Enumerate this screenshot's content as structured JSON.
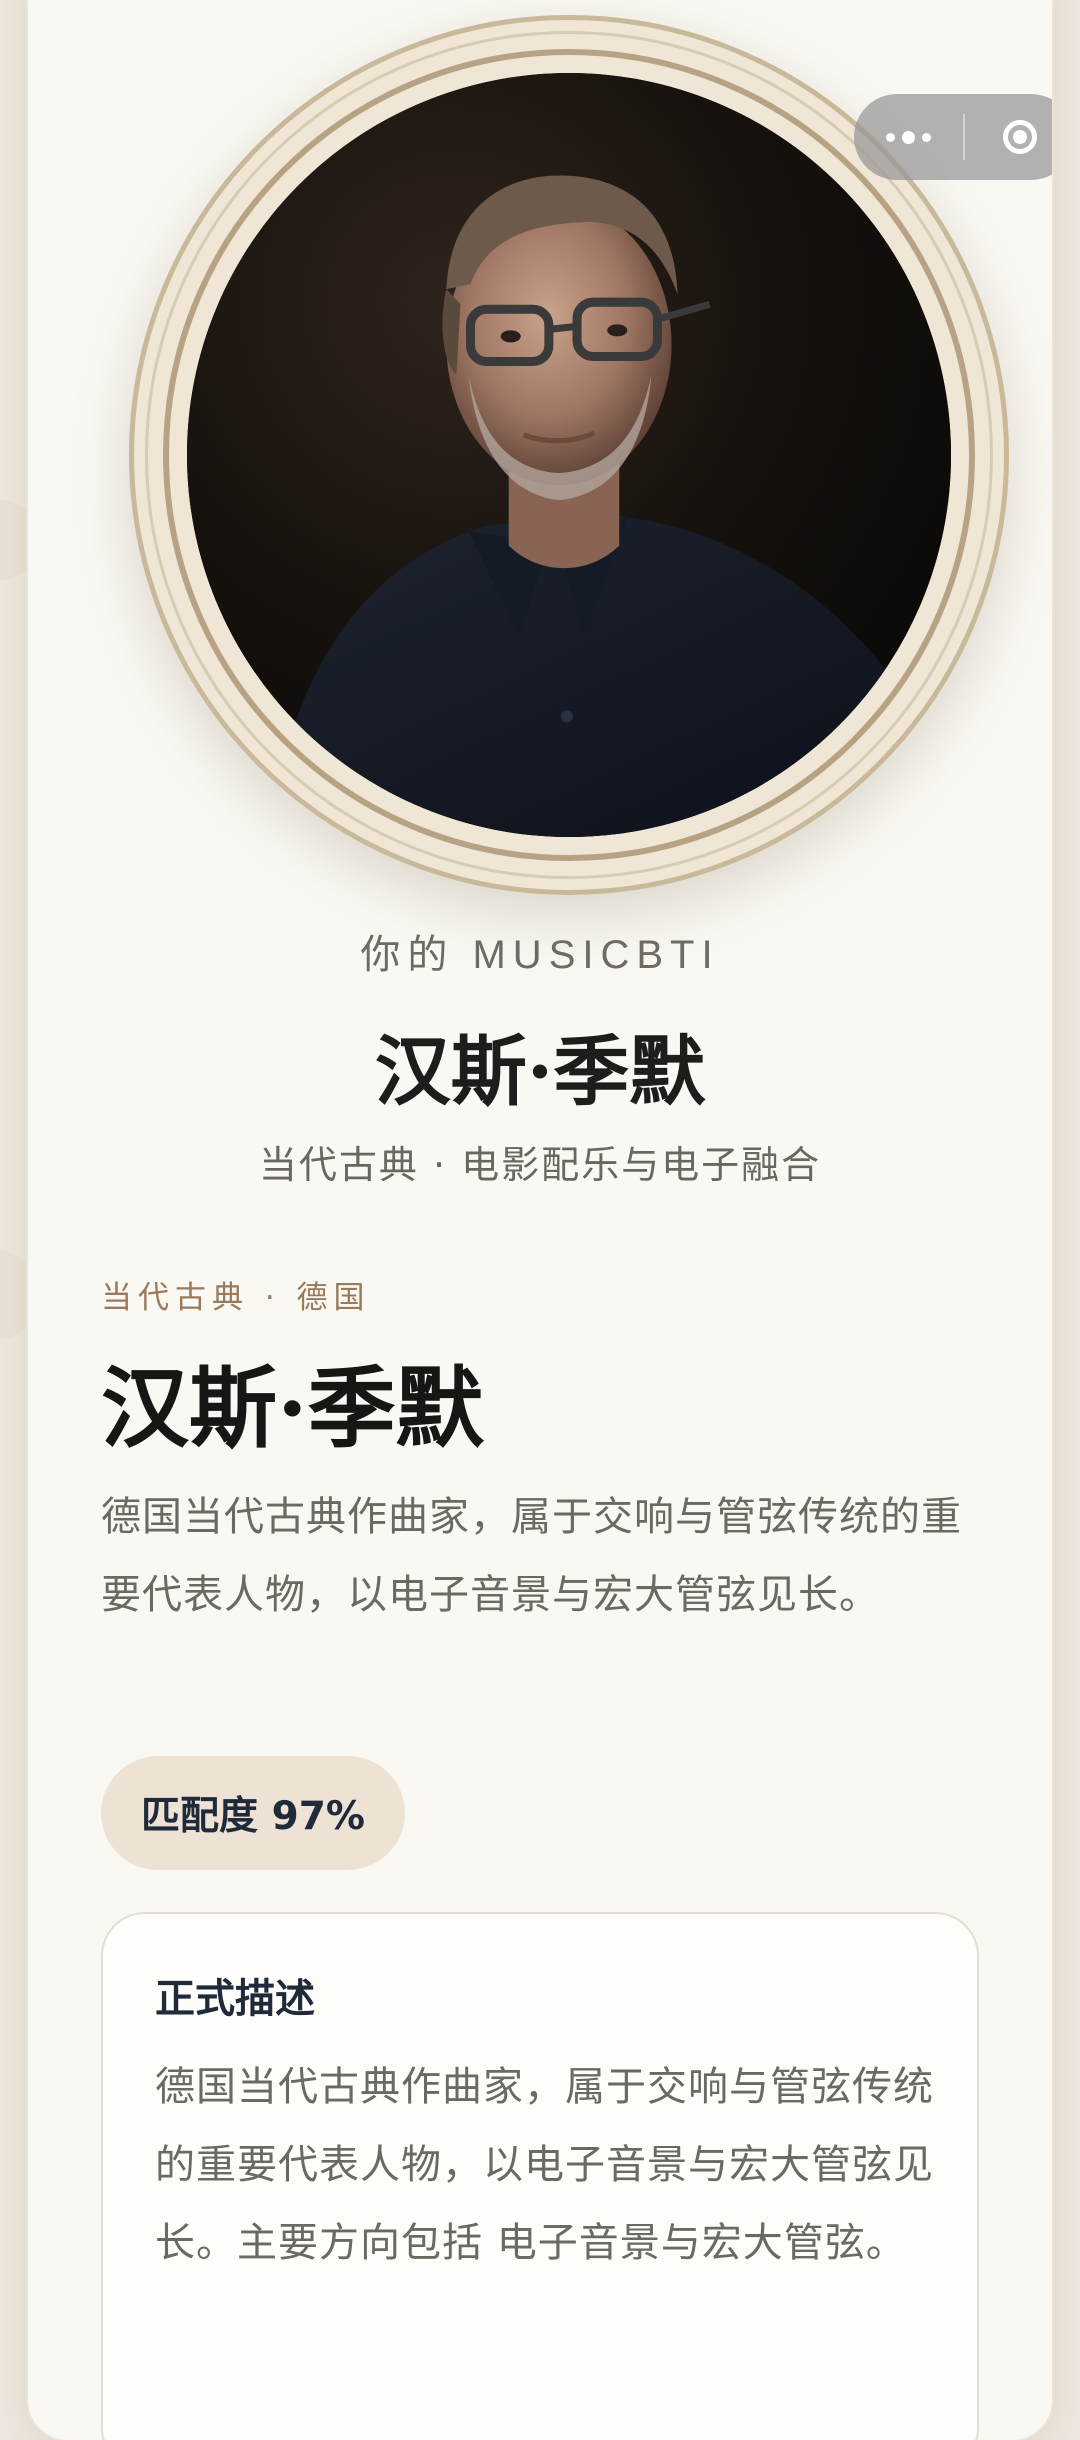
{
  "capsule": {
    "more_icon": "more-dots-icon",
    "close_icon": "target-circle-icon"
  },
  "portrait": {
    "icon": "portrait-photo"
  },
  "result": {
    "kicker": "你的 MUSICBTI",
    "name": "汉斯·季默",
    "subtitle": "当代古典 · 电影配乐与电子融合"
  },
  "profile": {
    "eyebrow": "当代古典 · 德国",
    "name": "汉斯·季默",
    "intro": "德国当代古典作曲家，属于交响与管弦传统的重要代表人物，以电子音景与宏大管弦见长。",
    "match_label": "匹配度 97%"
  },
  "description": {
    "title": "正式描述",
    "body": "德国当代古典作曲家，属于交响与管弦传统的重要代表人物，以电子音景与宏大管弦见长。主要方向包括 电子音景与宏大管弦。"
  },
  "colors": {
    "background": "#faf8f3",
    "accent": "#9a7a5b",
    "pill": "#eee2d4",
    "frame": "#b7a383"
  }
}
